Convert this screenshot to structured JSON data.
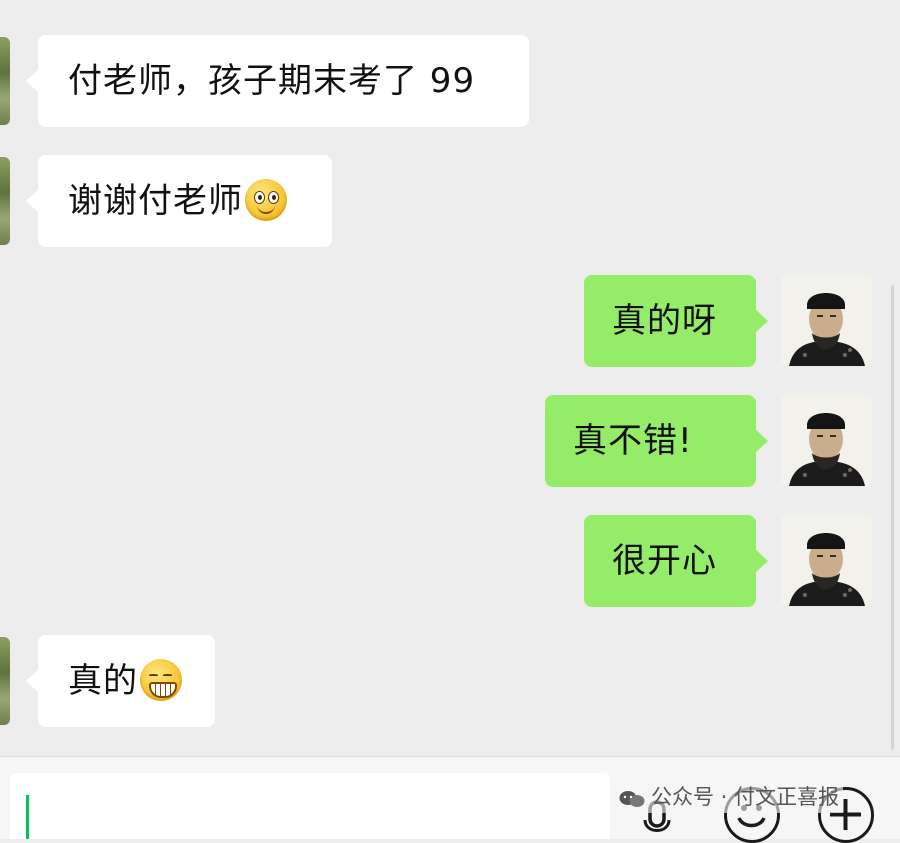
{
  "messages": [
    {
      "side": "left",
      "text": "付老师，孩子期末考了 99",
      "emoji": null
    },
    {
      "side": "left",
      "text": "谢谢付老师",
      "emoji": "smile-emoji-icon"
    },
    {
      "side": "right",
      "text": "真的呀",
      "emoji": null
    },
    {
      "side": "right",
      "text": "真不错!",
      "emoji": null
    },
    {
      "side": "right",
      "text": "很开心",
      "emoji": null
    },
    {
      "side": "left",
      "text": "真的",
      "emoji": "grin-emoji-icon"
    }
  ],
  "watermark": {
    "label": "公众号 · 付文正喜报"
  },
  "colors": {
    "chat_bg": "#ededed",
    "sent_bubble": "#95ec69",
    "received_bubble": "#ffffff",
    "cursor": "#07c160"
  }
}
